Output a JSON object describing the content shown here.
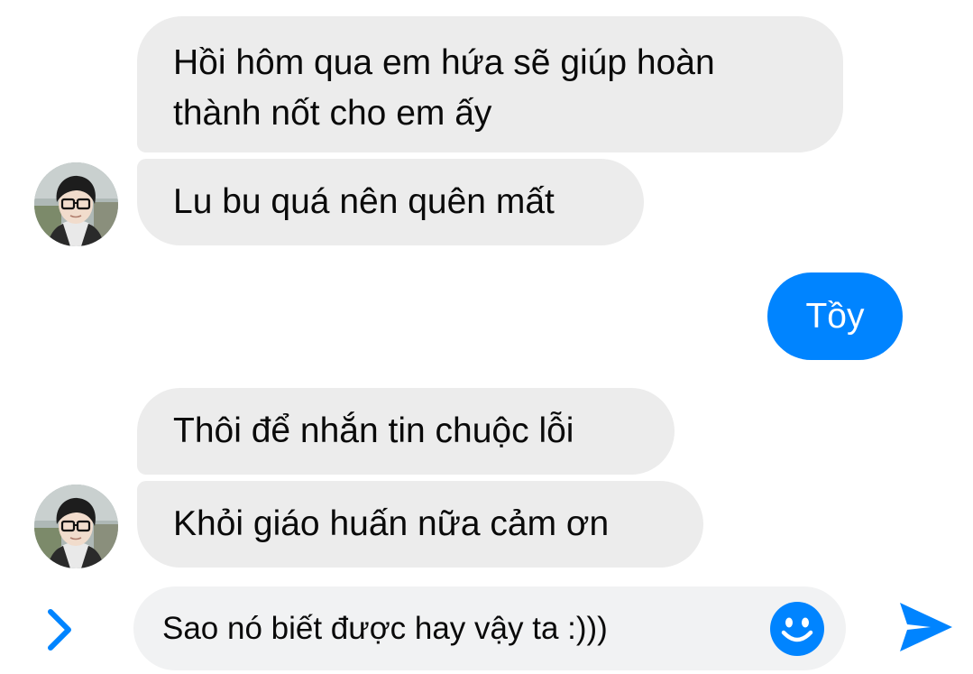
{
  "conversation": {
    "messages": [
      {
        "direction": "incoming",
        "lines": [
          "Hồi hôm qua em hứa sẽ giúp hoàn",
          "thành nốt cho em ấy"
        ]
      },
      {
        "direction": "incoming",
        "text": "Lu bu quá nên quên mất"
      },
      {
        "direction": "outgoing",
        "text": "Tồy"
      },
      {
        "direction": "incoming",
        "text": "Thôi để nhắn tin chuộc lỗi"
      },
      {
        "direction": "incoming",
        "text": "Khỏi giáo huấn nữa cảm ơn"
      }
    ]
  },
  "composer": {
    "text": "Sao nó biết được hay vậy ta :)))",
    "expand_icon": "chevron-right-icon",
    "emoji_icon": "smiley-icon",
    "send_icon": "send-icon"
  },
  "colors": {
    "accent": "#0084ff",
    "incoming_bubble": "#ececec",
    "composer_bg": "#f1f2f3"
  }
}
